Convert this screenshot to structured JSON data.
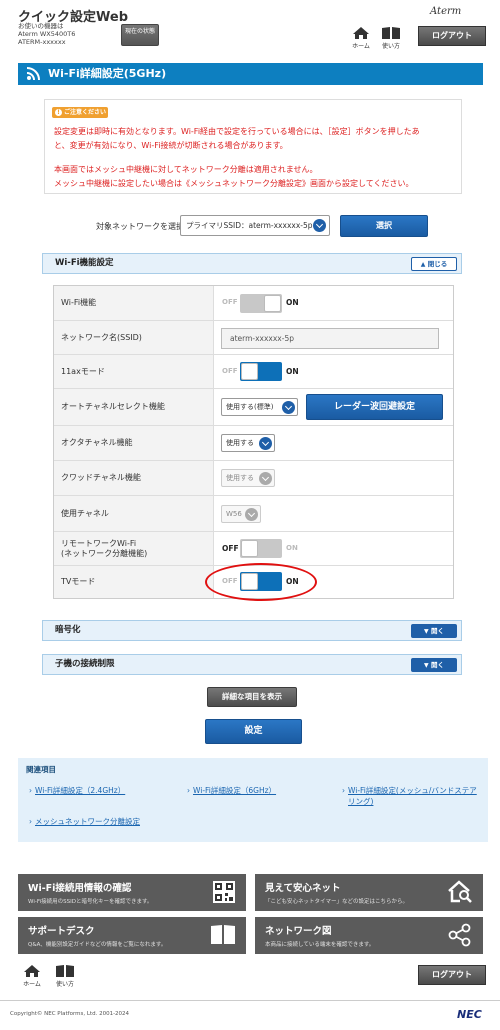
{
  "header": {
    "app_title": "クイック設定Web",
    "device_caption": "お使いの機器は",
    "device_model": "Aterm WX5400T6",
    "device_ssid": "ATERM-xxxxxx",
    "status_button": "現在の状態",
    "brand": "Aterm",
    "home_label": "ホーム",
    "manual_label": "使い方",
    "logout_label": "ログアウト"
  },
  "page_title": "Wi-Fi詳細設定(5GHz)",
  "notice": {
    "badge": "ご注意ください",
    "line1": "設定変更は即時に有効となります。Wi-Fi経由で設定を行っている場合には、［設定］ボタンを押したあ",
    "line2": "と、変更が有効になり、Wi-Fi接続が切断される場合があります。",
    "line3": "本画面ではメッシュ中継機に対してネットワーク分離は適用されません。",
    "line4": "メッシュ中継機に設定したい場合は《メッシュネットワーク分離設定》画面から設定してください。"
  },
  "target": {
    "label": "対象ネットワークを選択",
    "selected": "プライマリSSID：aterm-xxxxxx-5p",
    "select_button": "選択"
  },
  "wifi_section": {
    "title": "Wi-Fi機能設定",
    "collapse_label": "閉じる",
    "rows": {
      "wifi": {
        "label": "Wi-Fi機能",
        "off": "OFF",
        "on": "ON"
      },
      "ssid": {
        "label": "ネットワーク名(SSID)",
        "value": "aterm-xxxxxx-5p"
      },
      "ax": {
        "label": "11axモード",
        "off": "OFF",
        "on": "ON"
      },
      "acs": {
        "label": "オートチャネルセレクト機能",
        "value": "使用する(標準)",
        "radar_button": "レーダー波回避設定"
      },
      "octa": {
        "label": "オクタチャネル機能",
        "value": "使用する"
      },
      "quad": {
        "label": "クワッドチャネル機能",
        "value": "使用する"
      },
      "channel": {
        "label": "使用チャネル",
        "value": "W56"
      },
      "remote": {
        "label_line1": "リモートワークWi-Fi",
        "label_line2": "(ネットワーク分離機能)",
        "off": "OFF",
        "on": "ON"
      },
      "tv": {
        "label": "TVモード",
        "off": "OFF",
        "on": "ON"
      }
    }
  },
  "encryption_section": {
    "title": "暗号化",
    "expand_label": "開く"
  },
  "child_section": {
    "title": "子機の接続制限",
    "expand_label": "開く"
  },
  "show_details_button": "詳細な項目を表示",
  "apply_button": "設定",
  "related": {
    "title": "関連項目",
    "links": [
      "Wi-Fi詳細設定（2.4GHz）",
      "Wi-Fi詳細設定（6GHz）",
      "Wi-Fi詳細設定(メッシュ/バンドステアリング)",
      "メッシュネットワーク分離設定"
    ]
  },
  "tiles": [
    {
      "title": "Wi-Fi接続用情報の確認",
      "sub": "Wi-Fi接続用のSSIDと暗号化キーを確認できます。"
    },
    {
      "title": "見えて安心ネット",
      "sub": "「こども安心ネットタイマー」などの設定はこちらから。"
    },
    {
      "title": "サポートデスク",
      "sub": "Q&A、機能別設定ガイドなどの情報をご覧になれます。"
    },
    {
      "title": "ネットワーク図",
      "sub": "本商品に接続している端末を確認できます。"
    }
  ],
  "footer": {
    "home_label": "ホーム",
    "manual_label": "使い方",
    "logout_label": "ログアウト",
    "copyright": "Copyright© NEC Platforms, Ltd. 2001-2024",
    "nec": "NEC"
  },
  "colors": {
    "accent": "#0d7fc0",
    "button_blue": "#1f5fa8",
    "warning": "#d22222",
    "highlight_circle": "#e01010"
  }
}
